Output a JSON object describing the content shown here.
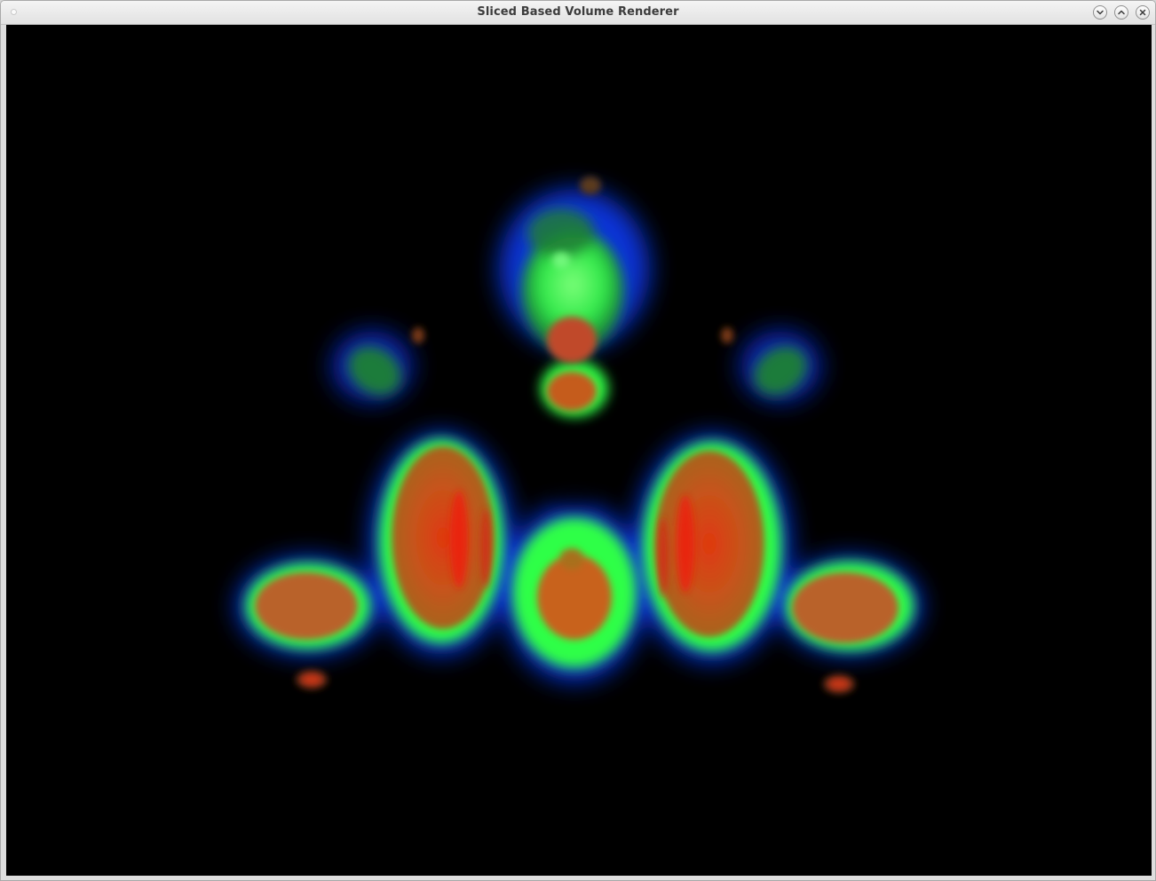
{
  "window": {
    "title": "Sliced Based Volume Renderer",
    "controls": {
      "minimize": "chevron-down-icon",
      "maximize": "chevron-up-icon",
      "close": "close-icon"
    }
  },
  "viewport": {
    "background": "#000000",
    "palette": {
      "inner": "#cf4a12",
      "shell": "#2dff45",
      "halo": "#0a3cff"
    }
  }
}
